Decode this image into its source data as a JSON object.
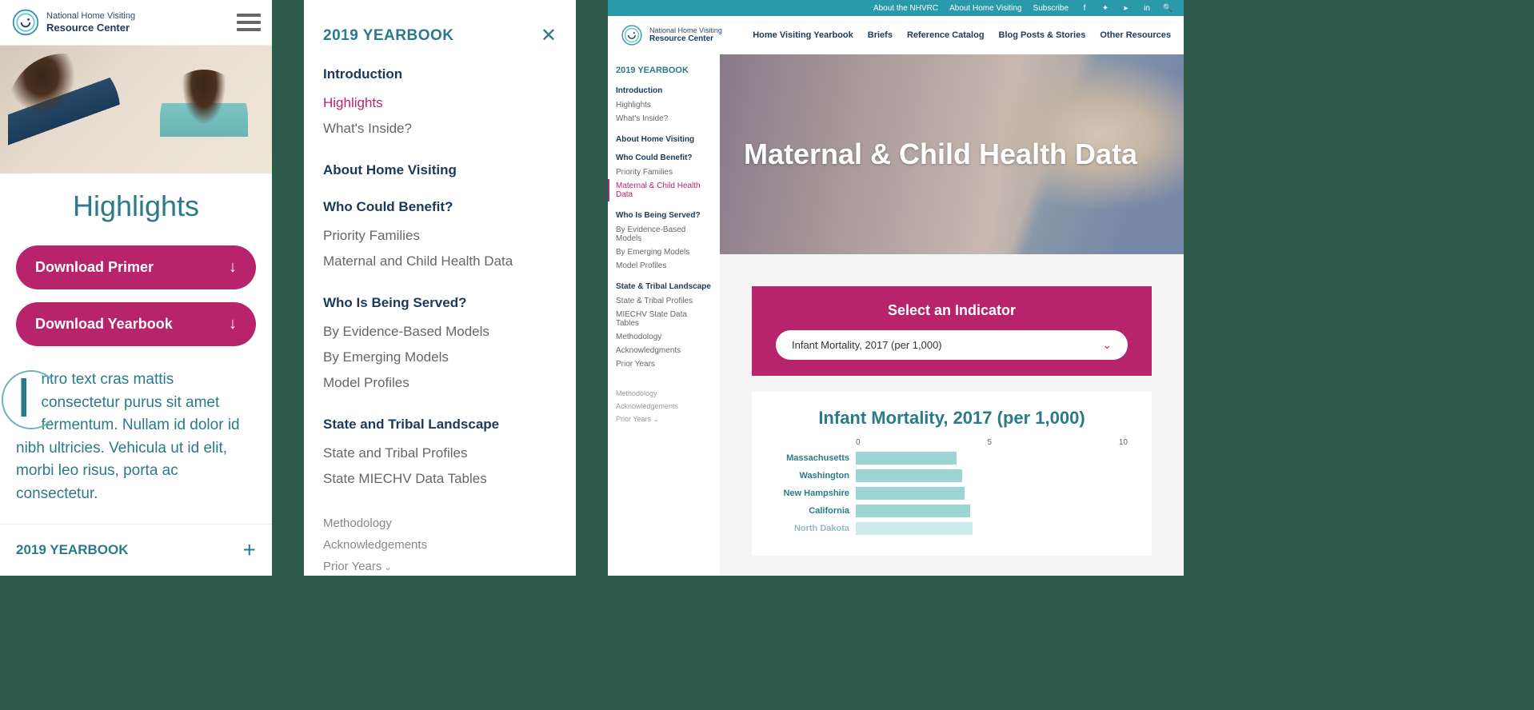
{
  "brand": {
    "line1": "National Home Visiting",
    "line2": "Resource Center"
  },
  "panel1": {
    "title": "Highlights",
    "btn_primer": "Download Primer",
    "btn_yearbook": "Download Yearbook",
    "intro_rest": "ntro text cras mattis consectetur purus sit amet fermentum. Nullam id dolor id nibh ultricies. Vehicula ut id elit, morbi leo risus, porta ac consectetur.",
    "footer_title": "2019 YEARBOOK"
  },
  "panel2": {
    "title": "2019 YEARBOOK",
    "sections": [
      {
        "heading": "Introduction",
        "items": [
          "Highlights",
          "What's Inside?"
        ],
        "activeIndex": 0
      },
      {
        "heading": "About Home Visiting",
        "items": []
      },
      {
        "heading": "Who Could Benefit?",
        "items": [
          "Priority Families",
          "Maternal and Child Health Data"
        ]
      },
      {
        "heading": "Who Is Being Served?",
        "items": [
          "By Evidence-Based Models",
          "By Emerging Models",
          "Model Profiles"
        ]
      },
      {
        "heading": "State and Tribal Landscape",
        "items": [
          "State and Tribal Profiles",
          "State MIECHV Data Tables"
        ]
      }
    ],
    "footer": [
      "Methodology",
      "Acknowledgements",
      "Prior Years"
    ]
  },
  "panel3": {
    "topbar": [
      "About the NHVRC",
      "About Home Visiting",
      "Subscribe"
    ],
    "nav": [
      "Home Visiting Yearbook",
      "Briefs",
      "Reference Catalog",
      "Blog Posts & Stories",
      "Other Resources"
    ],
    "sidebar": {
      "title": "2019 YEARBOOK",
      "sections": [
        {
          "heading": "Introduction",
          "items": [
            "Highlights",
            "What's Inside?"
          ]
        },
        {
          "heading": "About Home Visiting",
          "items": []
        },
        {
          "heading": "Who Could Benefit?",
          "items": [
            "Priority Families",
            "Maternal & Child Health Data"
          ],
          "activeIndex": 1
        },
        {
          "heading": "Who Is Being Served?",
          "items": [
            "By Evidence-Based Models",
            "By Emerging Models",
            "Model Profiles"
          ]
        },
        {
          "heading": "State & Tribal Landscape",
          "items": [
            "State & Tribal Profiles",
            "MIECHV State Data Tables"
          ]
        }
      ],
      "footer": [
        "Methodology",
        "Acknowledgments",
        "Prior Years"
      ],
      "bottom_footer": [
        "Methodology",
        "Acknowledgements",
        "Prior Years"
      ]
    },
    "hero_title": "Maternal & Child Health Data",
    "indicator": {
      "label": "Select an Indicator",
      "selected": "Infant Mortality, 2017 (per 1,000)"
    }
  },
  "chart_data": {
    "type": "bar",
    "title": "Infant Mortality, 2017 (per 1,000)",
    "xlabel": "",
    "ylabel": "",
    "xlim": [
      0,
      10
    ],
    "ticks": [
      "0",
      "5",
      "10"
    ],
    "categories": [
      "Massachusetts",
      "Washington",
      "New Hampshire",
      "California",
      "North Dakota"
    ],
    "values": [
      3.7,
      3.9,
      4.0,
      4.2,
      4.3
    ],
    "faded_index": 4
  }
}
